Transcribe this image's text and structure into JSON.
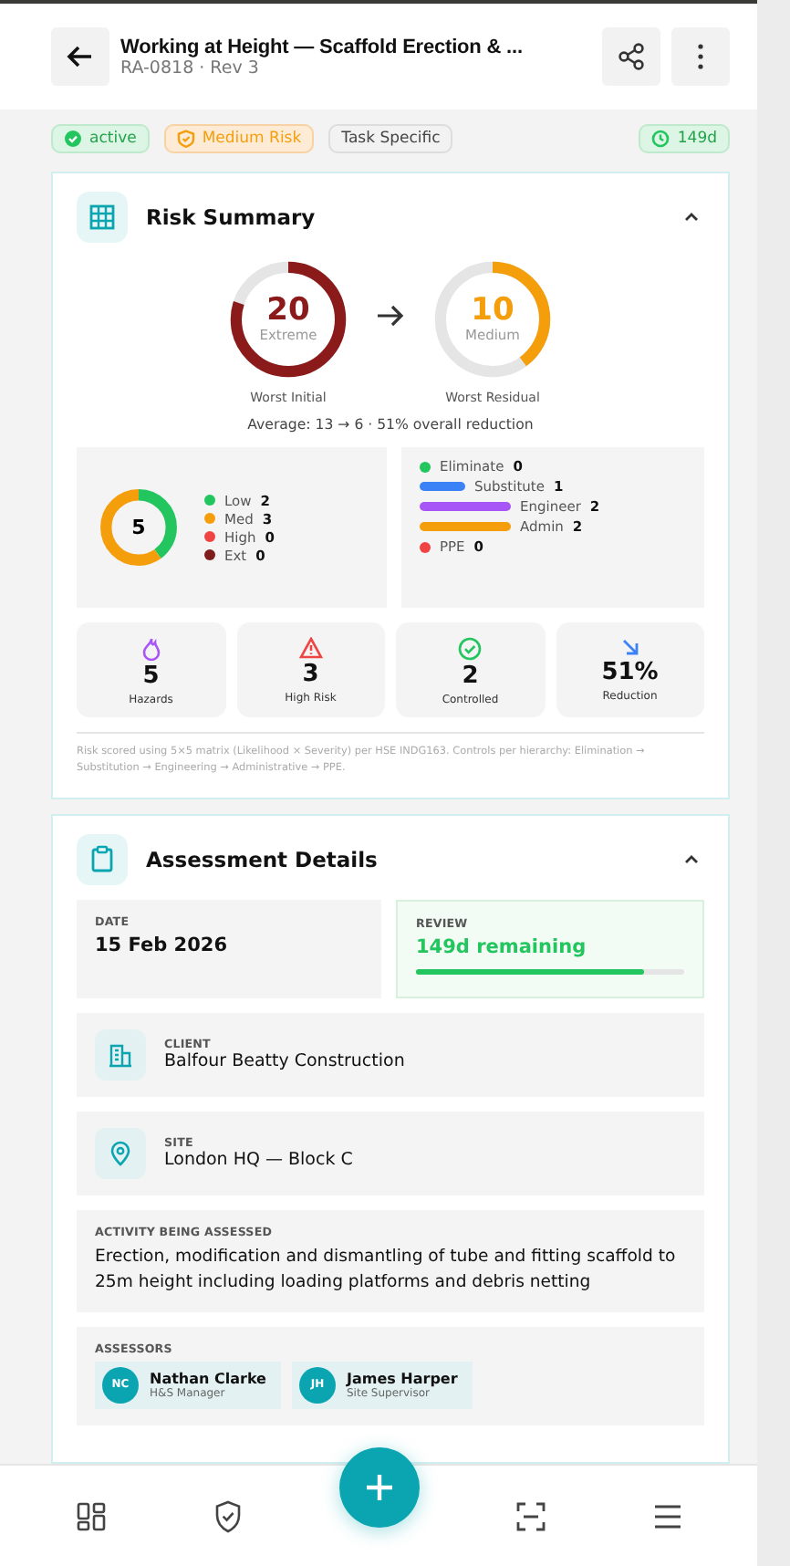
{
  "header": {
    "title": "Working at Height — Scaffold Erection & ...",
    "subtitle": "RA-0818 · Rev 3"
  },
  "badges": [
    {
      "kind": "status",
      "label": "active"
    },
    {
      "kind": "risk",
      "label": "Medium Risk"
    },
    {
      "kind": "plain",
      "label": "Task Specific"
    },
    {
      "kind": "time",
      "label": "149d"
    }
  ],
  "risk_summary": {
    "title": "Risk Summary",
    "expanded": true,
    "gauges": [
      {
        "score": "20",
        "rating": "Extreme",
        "caption": "Worst Initial",
        "level": 0.8,
        "color": "#8b1a1a"
      },
      {
        "score": "10",
        "rating": "Medium",
        "caption": "Worst Residual",
        "level": 0.4,
        "color": "#f59e0b"
      }
    ],
    "average": "Average: 13 → 6 · 51% overall reduction",
    "donut_total": "5",
    "levels": [
      {
        "label": "Low",
        "count": "2",
        "color": "#22c55e"
      },
      {
        "label": "Med",
        "count": "3",
        "color": "#f59e0b"
      },
      {
        "label": "High",
        "count": "0",
        "color": "#ef4444"
      },
      {
        "label": "Ext",
        "count": "0",
        "color": "#7f1d1d"
      }
    ],
    "hierarchy": [
      {
        "label": "Eliminate",
        "count": "0",
        "color": "#22c55e"
      },
      {
        "label": "Substitute",
        "count": "1",
        "color": "#3b82f6"
      },
      {
        "label": "Engineer",
        "count": "2",
        "color": "#a855f7"
      },
      {
        "label": "Admin",
        "count": "2",
        "color": "#f59e0b"
      },
      {
        "label": "PPE",
        "count": "0",
        "color": "#ef4444"
      }
    ],
    "stats": [
      {
        "kind": "hazards",
        "value": "5",
        "label": "Hazards"
      },
      {
        "kind": "high",
        "value": "3",
        "label": "High Risk"
      },
      {
        "kind": "controlled",
        "value": "2",
        "label": "Controlled"
      },
      {
        "kind": "reduction",
        "value": "51%",
        "label": "Reduction"
      }
    ],
    "note": "Risk scored using 5×5 matrix (Likelihood × Severity) per HSE INDG163. Controls per hierarchy: Elimination → Substitution → Engineering → Administrative → PPE."
  },
  "assessment_details": {
    "title": "Assessment Details",
    "expanded": true,
    "date": {
      "label": "DATE",
      "value": "15 Feb 2026"
    },
    "review": {
      "label": "REVIEW",
      "value": "149d remaining",
      "level": 0.85
    },
    "client": {
      "label": "CLIENT",
      "value": "Balfour Beatty Construction"
    },
    "site": {
      "label": "SITE",
      "value": "London HQ — Block C"
    },
    "activity": {
      "label": "ACTIVITY BEING ASSESSED",
      "value": "Erection, modification and dismantling of tube and fitting scaffold to 25m height including loading platforms and debris netting"
    },
    "assessors": {
      "label": "ASSESSORS",
      "people": [
        {
          "initials": "NC",
          "name": "Nathan Clarke",
          "role": "H&S Manager"
        },
        {
          "initials": "JH",
          "name": "James Harper",
          "role": "Site Supervisor"
        }
      ]
    }
  },
  "bottom_nav": [
    {
      "kind": "dashboard"
    },
    {
      "kind": "shield"
    },
    {
      "kind": "add"
    },
    {
      "kind": "scan"
    },
    {
      "kind": "menu"
    }
  ]
}
